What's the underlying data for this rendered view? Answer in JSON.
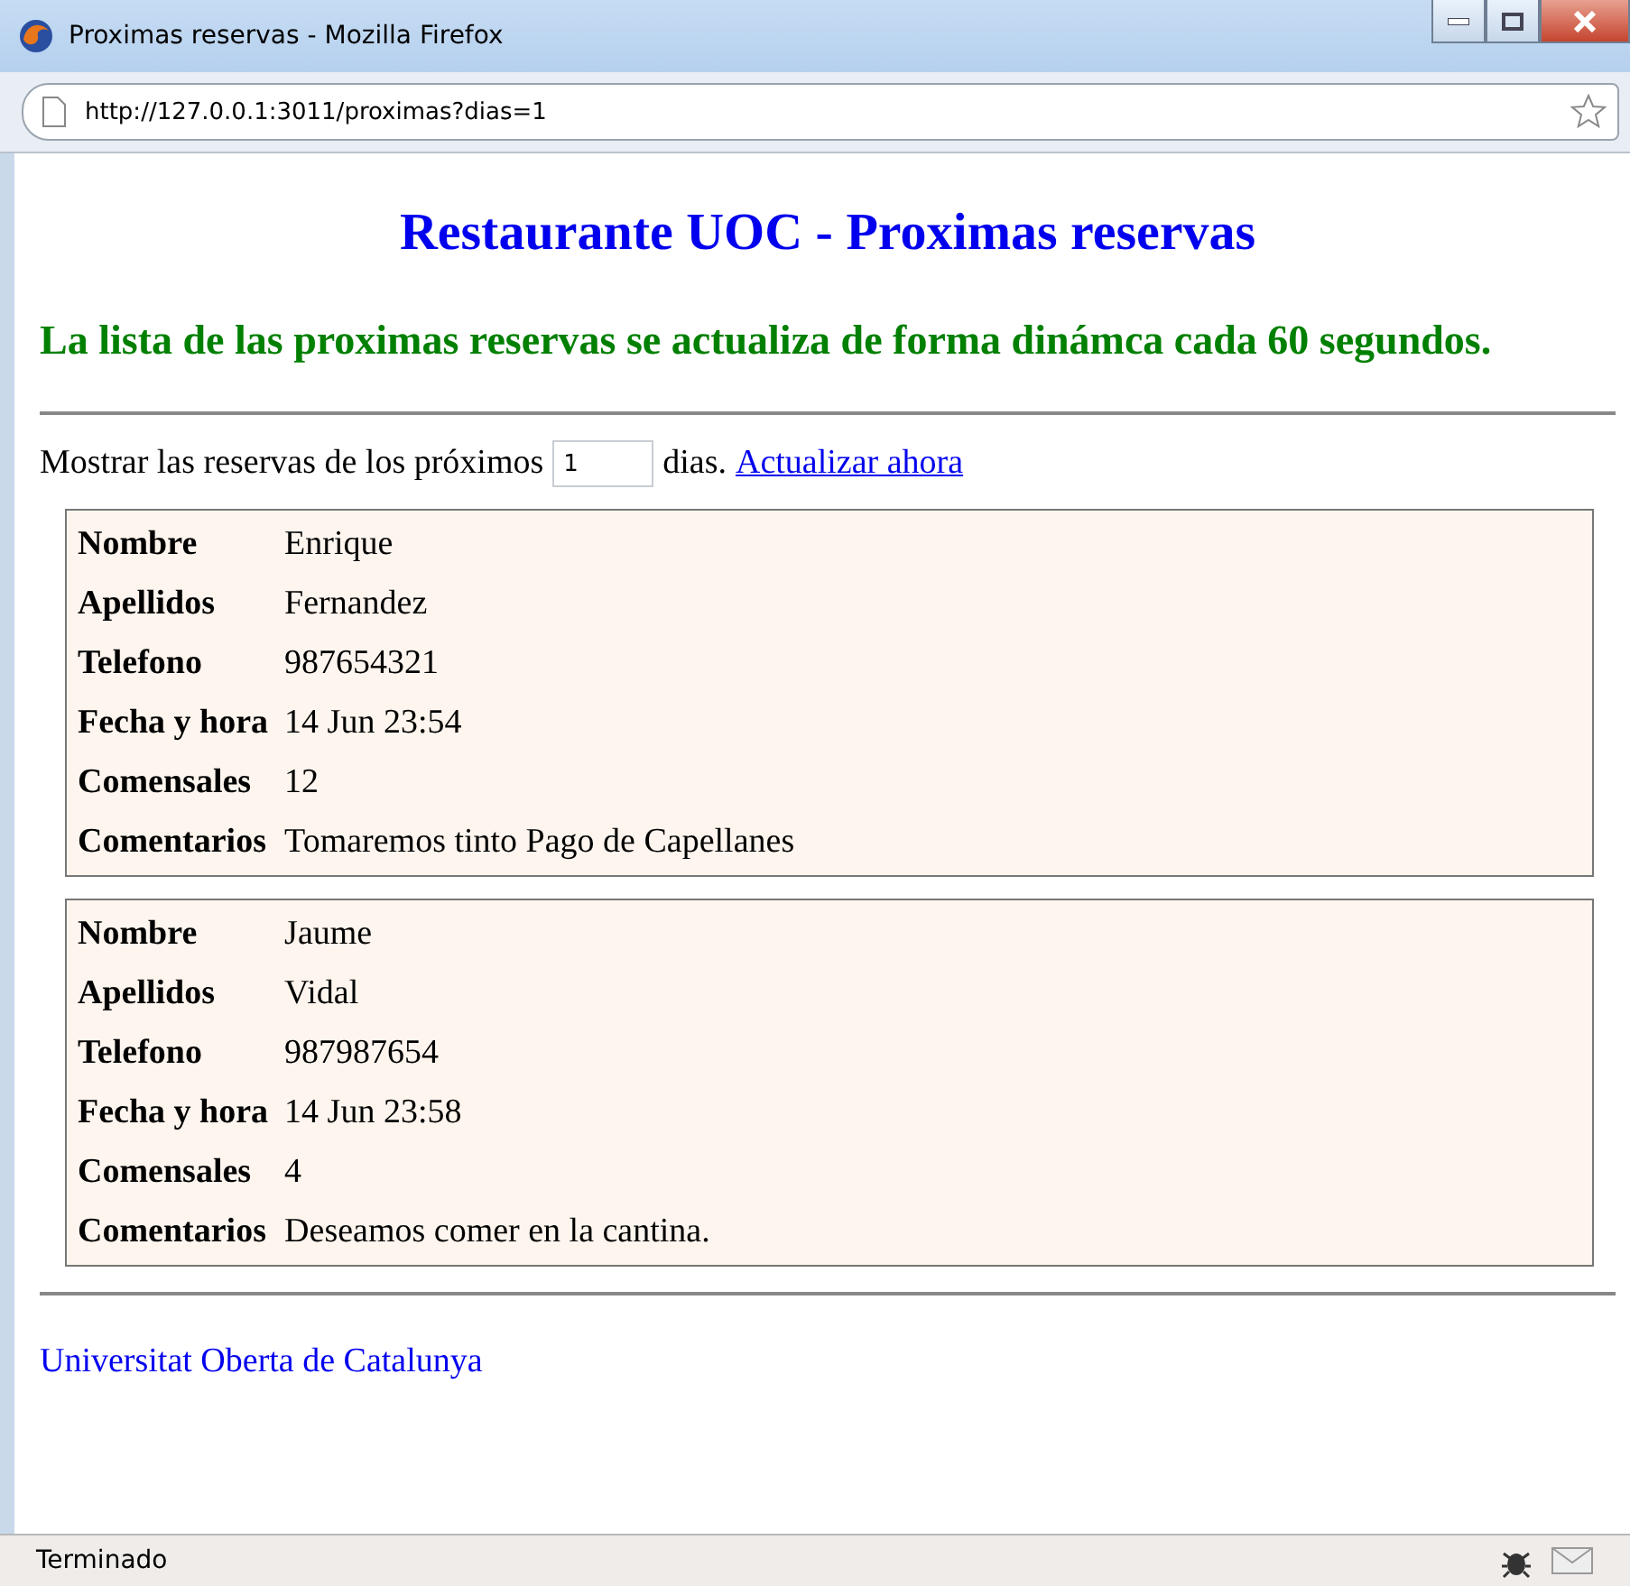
{
  "window": {
    "title": "Proximas reservas - Mozilla Firefox"
  },
  "address_bar": {
    "url": "http://127.0.0.1:3011/proximas?dias=1"
  },
  "page": {
    "heading": "Restaurante UOC - Proximas reservas",
    "notice": "La lista de las proximas reservas se actualiza de forma dinámca cada 60 segundos.",
    "filter": {
      "prefix": "Mostrar las reservas de los próximos",
      "value": "1",
      "suffix": "dias.",
      "link": "Actualizar ahora"
    },
    "reservations": [
      {
        "rows": [
          {
            "label": "Nombre",
            "value": "Enrique"
          },
          {
            "label": "Apellidos",
            "value": "Fernandez"
          },
          {
            "label": "Telefono",
            "value": "987654321"
          },
          {
            "label": "Fecha y hora",
            "value": "14 Jun 23:54"
          },
          {
            "label": "Comensales",
            "value": "12"
          },
          {
            "label": "Comentarios",
            "value": "Tomaremos tinto Pago de Capellanes"
          }
        ]
      },
      {
        "rows": [
          {
            "label": "Nombre",
            "value": "Jaume"
          },
          {
            "label": "Apellidos",
            "value": "Vidal"
          },
          {
            "label": "Telefono",
            "value": "987987654"
          },
          {
            "label": "Fecha y hora",
            "value": "14 Jun 23:58"
          },
          {
            "label": "Comensales",
            "value": "4"
          },
          {
            "label": "Comentarios",
            "value": "Deseamos comer en la cantina."
          }
        ]
      }
    ],
    "footer_link": "Universitat Oberta de Catalunya"
  },
  "status_bar": {
    "text": "Terminado"
  }
}
